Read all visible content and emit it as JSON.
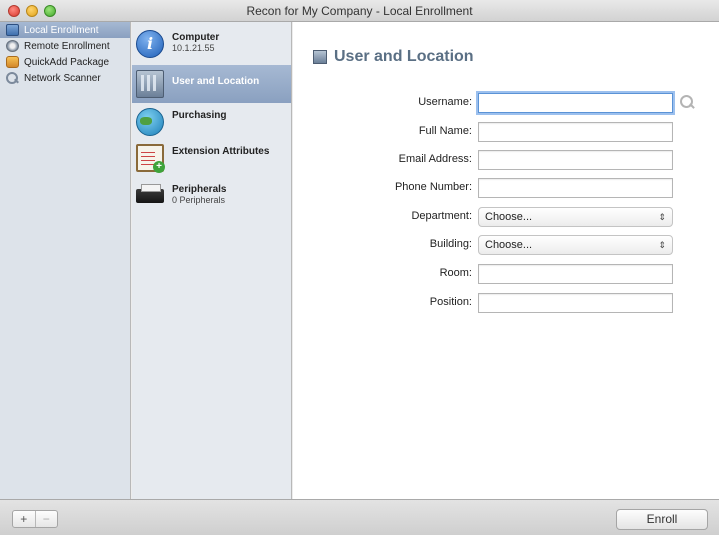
{
  "window": {
    "title": "Recon for My Company - Local Enrollment"
  },
  "sidebar": {
    "items": [
      {
        "label": "Local Enrollment",
        "icon": "monitor-icon",
        "selected": true
      },
      {
        "label": "Remote Enrollment",
        "icon": "remote-icon",
        "selected": false
      },
      {
        "label": "QuickAdd Package",
        "icon": "package-icon",
        "selected": false
      },
      {
        "label": "Network Scanner",
        "icon": "scanner-icon",
        "selected": false
      }
    ]
  },
  "categories": [
    {
      "label": "Computer",
      "sub": "10.1.21.55",
      "icon": "info-icon",
      "selected": false
    },
    {
      "label": "User and Location",
      "sub": "",
      "icon": "building-icon",
      "selected": true
    },
    {
      "label": "Purchasing",
      "sub": "",
      "icon": "globe-icon",
      "selected": false
    },
    {
      "label": "Extension Attributes",
      "sub": "",
      "icon": "clipboard-icon",
      "selected": false
    },
    {
      "label": "Peripherals",
      "sub": "0 Peripherals",
      "icon": "printer-icon",
      "selected": false
    }
  ],
  "main": {
    "heading": "User and Location",
    "fields": {
      "username": {
        "label": "Username:",
        "value": ""
      },
      "full_name": {
        "label": "Full Name:",
        "value": ""
      },
      "email": {
        "label": "Email Address:",
        "value": ""
      },
      "phone": {
        "label": "Phone Number:",
        "value": ""
      },
      "department": {
        "label": "Department:",
        "value": "Choose..."
      },
      "building": {
        "label": "Building:",
        "value": "Choose..."
      },
      "room": {
        "label": "Room:",
        "value": ""
      },
      "position": {
        "label": "Position:",
        "value": ""
      }
    }
  },
  "bottom": {
    "add_label": "+",
    "remove_label": "−",
    "enroll_label": "Enroll"
  },
  "colors": {
    "selection": "#8aa0c0",
    "heading": "#5a6f84",
    "focus_ring": "#9cc0ee"
  }
}
